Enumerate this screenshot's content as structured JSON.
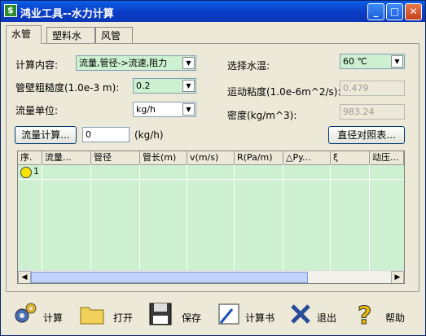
{
  "window": {
    "title": "鸿业工具--水力计算"
  },
  "tabs": [
    "水管",
    "塑料水管",
    "风管"
  ],
  "form": {
    "calc_content_label": "计算内容:",
    "calc_content_value": "流量,管径->流速,阻力",
    "roughness_label": "管壁粗糙度(1.0e-3 m):",
    "roughness_value": "0.2",
    "flow_unit_label": "流量单位:",
    "flow_unit_value": "kg/h",
    "flow_calc_button": "流量计算...",
    "flow_value": "0",
    "flow_unit_text": "(kg/h)",
    "water_temp_label": "选择水温:",
    "water_temp_value": "60 ℃",
    "viscosity_label": "运动粘度(1.0e-6m^2/s):",
    "viscosity_value": "0.479",
    "density_label": "密度(kg/m^3):",
    "density_value": "983.24",
    "diameter_table_button": "直径对照表..."
  },
  "table": {
    "columns": [
      "序.",
      "流量...",
      "管径",
      "管长(m)",
      "v(m/s)",
      "R(Pa/m)",
      "△Py...",
      "ξ",
      "动压..."
    ],
    "rows": [
      {
        "index": "1"
      }
    ]
  },
  "toolbar": {
    "calc": "计算",
    "open": "打开",
    "save": "保存",
    "report": "计算书",
    "exit": "退出",
    "help": "帮助"
  },
  "colors": {
    "titlebar": "#0A46D2",
    "grid_bg": "#CCF0D0",
    "window_bg": "#ECE9D8"
  }
}
